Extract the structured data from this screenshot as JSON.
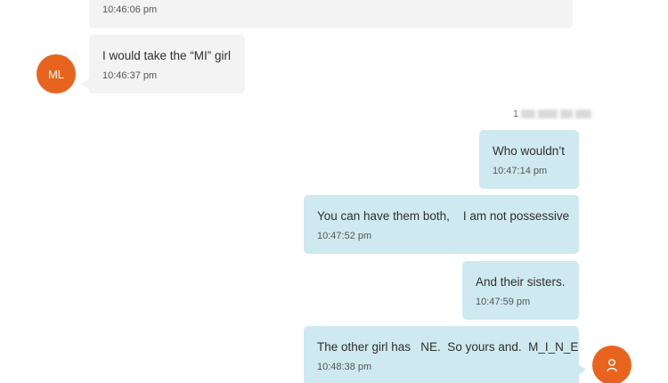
{
  "messages": [
    {
      "text": "",
      "time": "10:46:06 pm",
      "direction": "incoming"
    },
    {
      "text": "I would take the “MI” girl",
      "time": "10:46:37 pm",
      "direction": "incoming"
    },
    {
      "text": "Who wouldn’t",
      "time": "10:47:14 pm",
      "direction": "outgoing"
    },
    {
      "text": "You can have them both,    I am not possessive",
      "time": "10:47:52 pm",
      "direction": "outgoing"
    },
    {
      "text": "And their sisters.",
      "time": "10:47:59 pm",
      "direction": "outgoing"
    },
    {
      "text": "The other girl has   NE.  So yours and.  M_I_N_E",
      "time": "10:48:38 pm",
      "direction": "outgoing"
    }
  ],
  "contact": {
    "initials": "ML",
    "avatar_color": "#e8641e"
  },
  "self": {
    "avatar_icon": "person-icon",
    "avatar_color": "#e8641e"
  },
  "sender_label": {
    "visible_prefix": "1"
  },
  "colors": {
    "incoming_bubble": "#f3f3f3",
    "outgoing_bubble": "#cfe9f0"
  }
}
